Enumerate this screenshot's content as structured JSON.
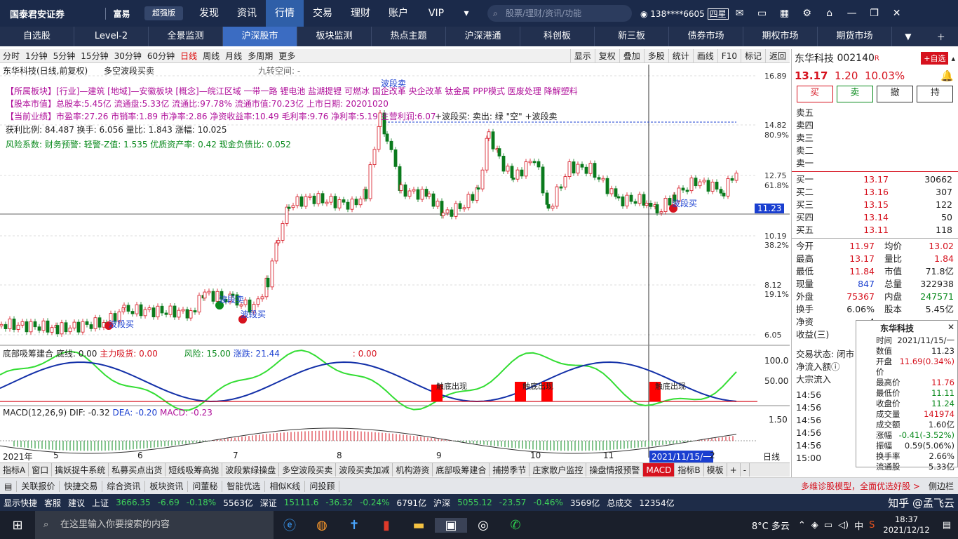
{
  "app": {
    "logo": "国泰君安证券",
    "logo_en": "GUOTAI JUNAN SECURITIES",
    "brand2": "富易",
    "brand2_en": "RICH EASY",
    "edition": "超强版"
  },
  "top_menu": [
    "发现",
    "资讯",
    "行情",
    "交易",
    "理财",
    "账户",
    "VIP"
  ],
  "top_active": "行情",
  "search_placeholder": "股票/理财/资讯/功能",
  "user": {
    "phone": "138****6605",
    "level": "四星"
  },
  "nav_tabs": [
    "自选股",
    "Level-2",
    "全景监测",
    "沪深股市",
    "板块监测",
    "热点主题",
    "沪深港通",
    "科创板",
    "新三板",
    "债券市场",
    "期权市场",
    "期货市场"
  ],
  "nav_active": "沪深股市",
  "period_tabs": [
    "分时",
    "1分钟",
    "5分钟",
    "15分钟",
    "30分钟",
    "60分钟",
    "日线",
    "周线",
    "月线",
    "多周期",
    "更多"
  ],
  "period_active": "日线",
  "chart_tools": [
    "显示",
    "复权",
    "叠加",
    "多股",
    "统计",
    "画线",
    "F10",
    "标记",
    "返回"
  ],
  "chart_header": {
    "stock": "东华科技(日线,前复权)",
    "indicator": "多空波段买卖",
    "nine": "九转空间: -"
  },
  "info_lines": [
    "【所属板块】[行业]—建筑 [地域]—安徽板块 [概念]—皖江区域 一带一路 锂电池 盐湖提锂 可燃冰 国企改革 央企改革 钛金属 PPP模式 医废处理 降解塑料",
    "【股本市值】总股本:5.45亿 流通盘:5.33亿 流通比:97.78% 流通市值:70.23亿 上市日期: 20201020",
    "【当前业绩】市盈率:27.26 市销率:1.89 市净率:2.86 净资收益率:10.49 毛利率:9.76 净利率:5.19 主营利润:6.07",
    "获利比例: 84.487    换手: 6.056       量比: 1.843      涨幅: 10.025",
    "风险系数: 财务预警: 轻警-Z值: 1.535 优质资产率: 0.42 现金负债比: 0.052"
  ],
  "signal_legend": "+波段买: 卖出: 绿 \"空\" +波段卖",
  "price_axis": [
    "16.89",
    "14.82",
    "80.9%",
    "12.75",
    "61.8%",
    "10.19",
    "38.2%",
    "8.12",
    "19.1%",
    "6.05"
  ],
  "current_price_tag": "11.23",
  "chart_labels": {
    "sell1": "波段卖",
    "buy1": "波段买",
    "sell2": "波段卖",
    "buy2": "波段买",
    "sell3": "波段卖",
    "buy3": "波段买"
  },
  "mid_indicator": {
    "name": "底部吸筹建合",
    "baseline": "底线: 0.00",
    "main": "主力吸货: 0.00",
    "risk": "风险: 15.00",
    "rise": "涨跌: 21.44",
    "extra": ": 0.00",
    "axis": [
      "100.0",
      "50.00"
    ],
    "tags": [
      "触底出现",
      "触底出现",
      "触底出现"
    ]
  },
  "macd": {
    "title": "MACD(12,26,9)",
    "dif": "DIF: -0.32",
    "dea": "DEA: -0.20",
    "macd": "MACD: -0.23",
    "axis": "1.50"
  },
  "x_axis": {
    "labels": [
      "2021年",
      "5",
      "6",
      "7",
      "8",
      "9",
      "10",
      "11",
      "2021/11/15/一",
      "2"
    ],
    "mode": "日线"
  },
  "chart_data": {
    "type": "candlestick",
    "title": "东华科技(日线,前复权)",
    "ylim": [
      6.05,
      16.89
    ],
    "yticks": [
      16.89,
      14.82,
      12.75,
      10.19,
      8.12,
      6.05
    ],
    "last": 11.23
  },
  "indicator_tabs": [
    "指标A",
    "窗口",
    "擒妖捉牛系统",
    "私募买点出货",
    "短线吸筹高抛",
    "波段紫绿操盘",
    "多空波段买卖",
    "波段买卖加减",
    "机构游资",
    "底部吸筹建合",
    "捕捞季节",
    "庄家散户监控",
    "操盘情报预警",
    "MACD",
    "指标B",
    "模板",
    "+",
    "-"
  ],
  "indicator_active": "MACD",
  "bottom_tabs": [
    "关联报价",
    "快捷交易",
    "综合资讯",
    "板块资讯",
    "问董秘",
    "智能优选",
    "相似K线",
    "问投顾"
  ],
  "bottom_promo": "多维诊股模型，全面优选好股 >",
  "bottom_right": "侧边栏",
  "stock": {
    "name": "东华科技",
    "code": "002140",
    "flag": "R",
    "add_btn": "+自选",
    "price": "13.17",
    "change": "1.20",
    "pct": "10.03%"
  },
  "trade_btns": [
    "买",
    "卖",
    "撤",
    "持"
  ],
  "sells": [
    "卖五",
    "卖四",
    "卖三",
    "卖二",
    "卖一"
  ],
  "buys": [
    {
      "label": "买一",
      "price": "13.17",
      "vol": "30662"
    },
    {
      "label": "买二",
      "price": "13.16",
      "vol": "307"
    },
    {
      "label": "买三",
      "price": "13.15",
      "vol": "122"
    },
    {
      "label": "买四",
      "price": "13.14",
      "vol": "50"
    },
    {
      "label": "买五",
      "price": "13.11",
      "vol": "118"
    }
  ],
  "stats": [
    {
      "l1": "今开",
      "v1": "11.97",
      "l2": "均价",
      "v2": "13.02"
    },
    {
      "l1": "最高",
      "v1": "13.17",
      "l2": "量比",
      "v2": "1.84"
    },
    {
      "l1": "最低",
      "v1": "11.84",
      "l2": "市值",
      "v2": "71.8亿"
    },
    {
      "l1": "现量",
      "v1": "847",
      "l2": "总量",
      "v2": "322938"
    },
    {
      "l1": "外盘",
      "v1": "75367",
      "l2": "内盘",
      "v2": "247571"
    },
    {
      "l1": "换手",
      "v1": "6.06%",
      "l2": "股本",
      "v2": "5.45亿"
    },
    {
      "l1": "净资",
      "v1": "4",
      "l2": "",
      "v2": ""
    },
    {
      "l1": "收益(三)",
      "v1": "0.3",
      "l2": "",
      "v2": ""
    }
  ],
  "trade_status": "交易状态: 闭市",
  "netflow": "净流入额",
  "block": "大宗流入",
  "ticks": [
    "14:56",
    "14:56",
    "14:56",
    "14:56",
    "14:56",
    "15:00"
  ],
  "popup": {
    "title": "东华科技",
    "rows": [
      [
        "时间",
        "2021/11/15/一"
      ],
      [
        "数值",
        "11.23"
      ],
      [
        "开盘价",
        "11.69(0.34%)"
      ],
      [
        "最高价",
        "11.76"
      ],
      [
        "最低价",
        "11.11"
      ],
      [
        "收盘价",
        "11.24"
      ],
      [
        "成交量",
        "141974"
      ],
      [
        "成交额",
        "1.60亿"
      ],
      [
        "涨幅",
        "-0.41(-3.52%)"
      ],
      [
        "振幅",
        "0.59(5.06%)"
      ],
      [
        "换手率",
        "2.66%"
      ],
      [
        "流通股",
        "5.33亿"
      ]
    ]
  },
  "status": {
    "quick": "显示快捷",
    "service": "客服",
    "suggest": "建议",
    "sh_name": "上证",
    "sh": "3666.35",
    "sh_chg": "-6.69",
    "sh_pct": "-0.18%",
    "sh_amt": "5563亿",
    "sz_name": "深证",
    "sz": "15111.6",
    "sz_chg": "-36.32",
    "sz_pct": "-0.24%",
    "sz_amt": "6791亿",
    "hs_name": "沪深",
    "hs": "5055.12",
    "hs_chg": "-23.57",
    "hs_pct": "-0.46%",
    "hs_amt": "3569亿",
    "total_name": "总成交",
    "total": "12354亿",
    "watermark": "知乎 @孟飞云"
  },
  "taskbar": {
    "search": "在这里输入你要搜索的内容",
    "weather": "8°C 多云",
    "ime": "中",
    "time": "18:37",
    "date": "2021/12/12"
  }
}
